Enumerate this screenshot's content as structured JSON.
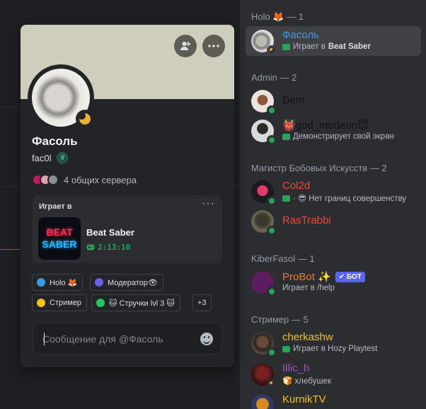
{
  "popout": {
    "display_name": "Фасоль",
    "username": "fac0l",
    "username_badge": "#",
    "mutual_servers": "4 общих сервера",
    "activity": {
      "label": "Играет в",
      "more": "···",
      "game_title": "Beat Saber",
      "logo_top": "BEAT",
      "logo_bottom": "SABER",
      "elapsed": "2:13:10"
    },
    "roles": [
      {
        "label": "Holo 🦊",
        "color": "#3b9bdf"
      },
      {
        "label": "Модератор👁",
        "color": "#6a61e6"
      },
      {
        "label": "Стример",
        "color": "#f1c40f"
      },
      {
        "label": "🐱 Стручки lvl 3 🐱",
        "color": "#22c55e"
      }
    ],
    "more_roles": "+3",
    "message_placeholder": "Сообщение для @Фасоль"
  },
  "member_list": {
    "groups": [
      {
        "title": "Holo 🦊 — 1"
      },
      {
        "title": "Admin — 2"
      },
      {
        "title": "Магистр Бобовых Искусств — 2"
      },
      {
        "title": "KiberFasol — 1"
      },
      {
        "title": "Стример — 5"
      }
    ],
    "members": [
      {
        "name": "Фасоль",
        "name_color": "#3b9bdf",
        "activity_prefix": "Играет в",
        "activity_game": "Beat Saber",
        "status": "idle"
      },
      {
        "name": "Dem",
        "name_color": "#111214",
        "status": "online"
      },
      {
        "name": "👹god_modeon😇",
        "name_color": "#111214",
        "activity": "Демонстрирует свой экран",
        "status": "online"
      },
      {
        "name": "Col2d",
        "name_color": "#e74c3c",
        "activity": "· 😎 Нет границ совершенству",
        "status": "online"
      },
      {
        "name": "RasTrabbi",
        "name_color": "#e74c3c",
        "status": "online"
      },
      {
        "name": "ProBot ✨",
        "name_color": "#f07b26",
        "bot_badge": "✔ БОТ",
        "activity": "Играет в /help",
        "status": "online"
      },
      {
        "name": "cherkashw",
        "name_color": "#f1c40f",
        "activity": "Играет в Hozy Playtest",
        "status": "online"
      },
      {
        "name": "Illic_h",
        "name_color": "#9b59b6",
        "activity": "🍞 хлебушек",
        "status": "idle"
      },
      {
        "name": "KurnikTV",
        "name_color": "#f1c40f",
        "status": "online"
      }
    ]
  },
  "colors": {
    "online": "#23a55a",
    "idle": "#f0b232",
    "bot": "#5865f2"
  }
}
